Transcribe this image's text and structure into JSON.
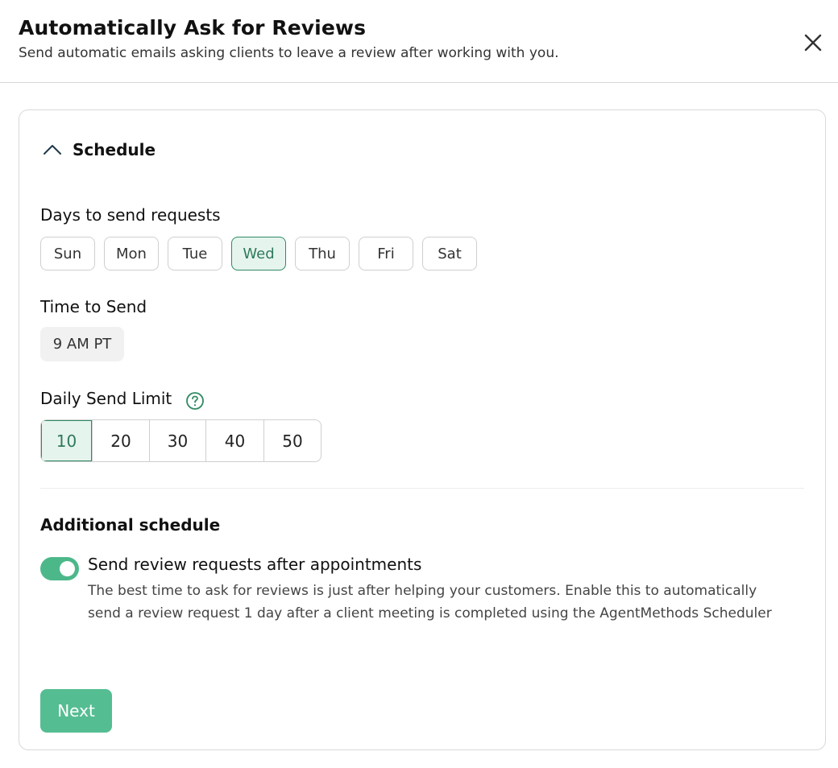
{
  "header": {
    "title": "Automatically Ask for Reviews",
    "subtitle": "Send automatic emails asking clients to leave a review after working with you."
  },
  "schedule": {
    "section_title": "Schedule",
    "expanded": true,
    "days_label": "Days to send requests",
    "days": [
      {
        "label": "Sun",
        "selected": false
      },
      {
        "label": "Mon",
        "selected": false
      },
      {
        "label": "Tue",
        "selected": false
      },
      {
        "label": "Wed",
        "selected": true
      },
      {
        "label": "Thu",
        "selected": false
      },
      {
        "label": "Fri",
        "selected": false
      },
      {
        "label": "Sat",
        "selected": false
      }
    ],
    "time_label": "Time to Send",
    "time_value": "9 AM PT",
    "limit_label": "Daily Send Limit",
    "limit_options": [
      {
        "label": "10",
        "selected": true
      },
      {
        "label": "20",
        "selected": false
      },
      {
        "label": "30",
        "selected": false
      },
      {
        "label": "40",
        "selected": false
      },
      {
        "label": "50",
        "selected": false
      }
    ]
  },
  "additional": {
    "title": "Additional schedule",
    "toggle_on": true,
    "toggle_title": "Send review requests after appointments",
    "toggle_description": "The best time to ask for reviews is just after helping your customers. Enable this to automatically send a review request 1 day after a client meeting is completed using the AgentMethods Scheduler"
  },
  "actions": {
    "next_label": "Next"
  },
  "colors": {
    "accent": "#55bd92",
    "accent_dark": "#2f8a63",
    "selected_bg": "#e6f4ee",
    "toggle_on": "#4cb88a"
  }
}
